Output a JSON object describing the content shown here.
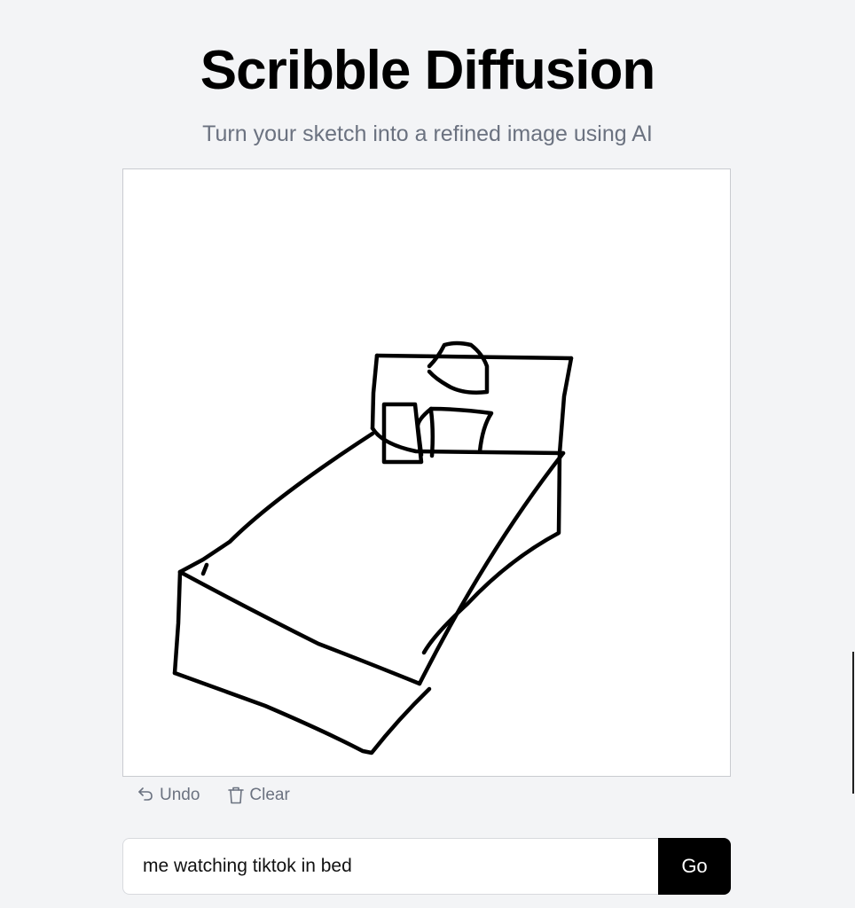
{
  "header": {
    "title": "Scribble Diffusion",
    "subtitle": "Turn your sketch into a refined image using AI"
  },
  "canvas": {
    "background": "#ffffff",
    "stroke_color": "#000000"
  },
  "tools": {
    "undo_label": "Undo",
    "undo_icon": "undo-arrow-icon",
    "clear_label": "Clear",
    "clear_icon": "trash-icon"
  },
  "prompt": {
    "value": "me watching tiktok in bed",
    "submit_label": "Go"
  }
}
